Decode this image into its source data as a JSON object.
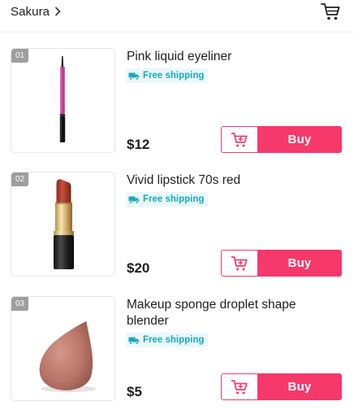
{
  "header": {
    "store_name": "Sakura",
    "chevron_icon": "chevron-right-icon",
    "cart_icon": "shopping-cart-icon"
  },
  "colors": {
    "accent": "#f6386a",
    "shipping_text": "#19a9bd",
    "shipping_bg": "#eaf8fa",
    "rank_bg": "#9e9e9e"
  },
  "products": [
    {
      "rank": "01",
      "title": "Pink liquid eyeliner",
      "shipping": "Free shipping",
      "price": "$12",
      "buy_label": "Buy",
      "image": "pink-eyeliner-pen"
    },
    {
      "rank": "02",
      "title": "Vivid lipstick 70s red",
      "shipping": "Free shipping",
      "price": "$20",
      "buy_label": "Buy",
      "image": "red-lipstick"
    },
    {
      "rank": "03",
      "title": "Makeup sponge droplet shape blender",
      "shipping": "Free shipping",
      "price": "$5",
      "buy_label": "Buy",
      "image": "makeup-sponge"
    }
  ]
}
